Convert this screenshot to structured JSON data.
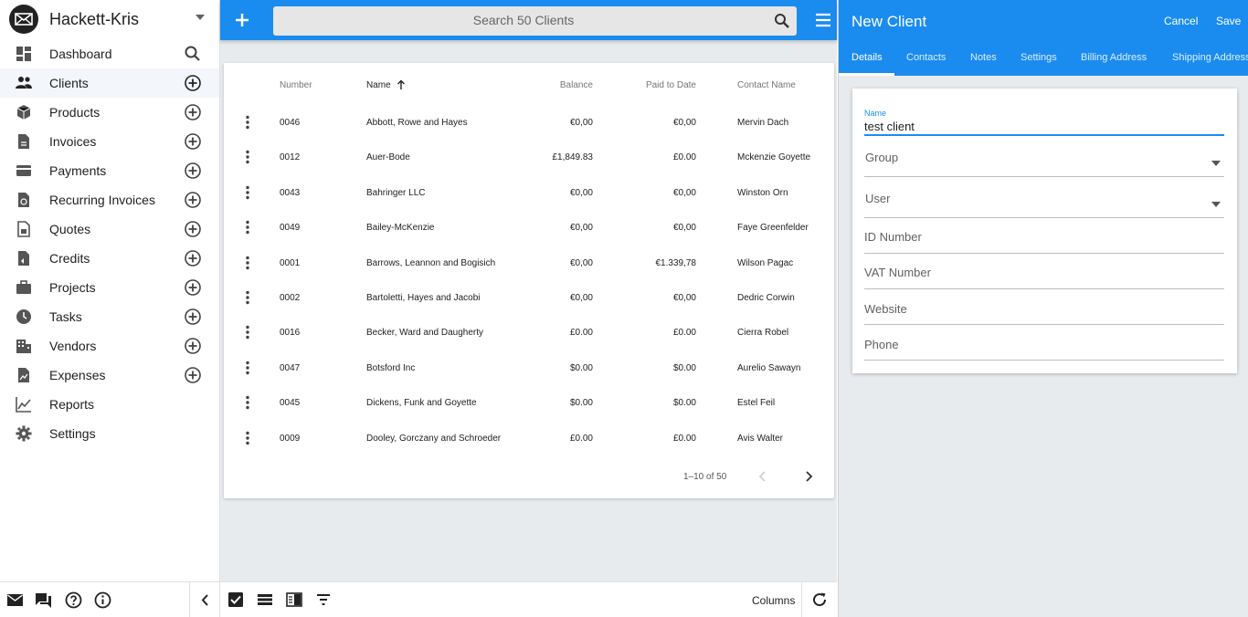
{
  "sidebar": {
    "company": "Hackett-Kris",
    "items": [
      {
        "label": "Dashboard",
        "icon": "dashboard-icon",
        "action": "search"
      },
      {
        "label": "Clients",
        "icon": "people-icon",
        "action": "add",
        "active": true
      },
      {
        "label": "Products",
        "icon": "box-icon",
        "action": "add"
      },
      {
        "label": "Invoices",
        "icon": "invoice-icon",
        "action": "add"
      },
      {
        "label": "Payments",
        "icon": "credit-card-icon",
        "action": "add"
      },
      {
        "label": "Recurring Invoices",
        "icon": "recurring-icon",
        "action": "add"
      },
      {
        "label": "Quotes",
        "icon": "quote-icon",
        "action": "add"
      },
      {
        "label": "Credits",
        "icon": "credit-icon",
        "action": "add"
      },
      {
        "label": "Projects",
        "icon": "briefcase-icon",
        "action": "add"
      },
      {
        "label": "Tasks",
        "icon": "clock-icon",
        "action": "add"
      },
      {
        "label": "Vendors",
        "icon": "building-icon",
        "action": "add"
      },
      {
        "label": "Expenses",
        "icon": "expense-icon",
        "action": "add"
      },
      {
        "label": "Reports",
        "icon": "chart-line-icon",
        "action": ""
      },
      {
        "label": "Settings",
        "icon": "gear-icon",
        "action": ""
      }
    ]
  },
  "search": {
    "placeholder": "Search 50 Clients"
  },
  "table": {
    "headers": {
      "number": "Number",
      "name": "Name",
      "balance": "Balance",
      "paid": "Paid to Date",
      "contact": "Contact Name"
    },
    "rows": [
      {
        "number": "0046",
        "name": "Abbott, Rowe and Hayes",
        "balance": "€0,00",
        "paid": "€0,00",
        "contact": "Mervin Dach"
      },
      {
        "number": "0012",
        "name": "Auer-Bode",
        "balance": "£1,849.83",
        "paid": "£0.00",
        "contact": "Mckenzie Goyette"
      },
      {
        "number": "0043",
        "name": "Bahringer LLC",
        "balance": "€0,00",
        "paid": "€0,00",
        "contact": "Winston Orn"
      },
      {
        "number": "0049",
        "name": "Bailey-McKenzie",
        "balance": "€0,00",
        "paid": "€0,00",
        "contact": "Faye Greenfelder"
      },
      {
        "number": "0001",
        "name": "Barrows, Leannon and Bogisich",
        "balance": "€0,00",
        "paid": "€1.339,78",
        "contact": "Wilson Pagac"
      },
      {
        "number": "0002",
        "name": "Bartoletti, Hayes and Jacobi",
        "balance": "€0,00",
        "paid": "€0,00",
        "contact": "Dedric Corwin"
      },
      {
        "number": "0016",
        "name": "Becker, Ward and Daugherty",
        "balance": "£0.00",
        "paid": "£0.00",
        "contact": "Cierra Robel"
      },
      {
        "number": "0047",
        "name": "Botsford Inc",
        "balance": "$0.00",
        "paid": "$0.00",
        "contact": "Aurelio Sawayn"
      },
      {
        "number": "0045",
        "name": "Dickens, Funk and Goyette",
        "balance": "$0.00",
        "paid": "$0.00",
        "contact": "Estel Feil"
      },
      {
        "number": "0009",
        "name": "Dooley, Gorczany and Schroeder",
        "balance": "£0.00",
        "paid": "£0.00",
        "contact": "Avis Walter"
      }
    ],
    "pagination": "1–10 of 50"
  },
  "bottombar": {
    "columns_label": "Columns"
  },
  "panel": {
    "title": "New Client",
    "cancel": "Cancel",
    "save": "Save",
    "tabs": [
      "Details",
      "Contacts",
      "Notes",
      "Settings",
      "Billing Address",
      "Shipping Address"
    ],
    "fields": {
      "name_label": "Name",
      "name_value": "test client",
      "group": "Group",
      "user": "User",
      "id_number": "ID Number",
      "vat_number": "VAT Number",
      "website": "Website",
      "phone": "Phone"
    }
  },
  "colors": {
    "primary": "#1a8cf0",
    "background": "#e8ebee",
    "active_item": "#f3f6fa"
  }
}
